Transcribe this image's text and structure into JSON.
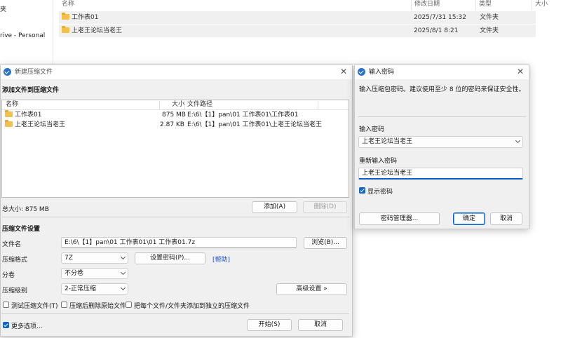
{
  "explorer": {
    "sidebar": [
      "夹",
      "rive - Personal"
    ],
    "columns": [
      "名称",
      "修改日期",
      "类型",
      "大小"
    ],
    "rows": [
      {
        "name": "工作表01",
        "date": "2025/7/31 15:32",
        "type": "文件夹"
      },
      {
        "name": "上老王论坛当老王",
        "date": "2025/8/1 8:21",
        "type": "文件夹"
      }
    ]
  },
  "archive_dialog": {
    "title": "新建压缩文件",
    "section_add": "添加文件到压缩文件",
    "list_columns": {
      "name": "名称",
      "size": "大小",
      "path": "文件路径"
    },
    "files": [
      {
        "name": "工作表01",
        "size": "875 MB",
        "path": "E:\\6\\【1】pan\\01 工作表01\\工作表01"
      },
      {
        "name": "上老王论坛当老王",
        "size": "2.87 KB",
        "path": "E:\\6\\【1】pan\\01 工作表01\\上老王论坛当老王"
      }
    ],
    "total_size": "总大小: 875 MB",
    "add_button": "添加(A)",
    "delete_button": "删除(D)",
    "section_settings": "压缩文件设置",
    "filename_label": "文件名",
    "filename_value": "E:\\6\\【1】pan\\01 工作表01\\01 工作表01.7z",
    "browse_button": "浏览(B)...",
    "format_label": "压缩格式",
    "format_value": "7Z",
    "set_password_button": "设置密码(P)...",
    "help_link": "[帮助]",
    "split_label": "分卷",
    "split_value": "不分卷",
    "level_label": "压缩级别",
    "level_value": "2-正常压缩",
    "advanced_button": "高级设置 »",
    "opt_test": "测试压缩文件(T)",
    "opt_delete": "压缩后删除原始文件",
    "opt_each": "把每个文件/文件夹添加到独立的压缩文件",
    "more_options": "更多选项...",
    "start_button": "开始(S)",
    "cancel_button": "取消"
  },
  "password_dialog": {
    "title": "输入密码",
    "hint": "输入压缩包密码。建议使用至少 8 位的密码来保证安全性。",
    "password_label": "输入密码",
    "password_value": "上老王论坛当老王",
    "confirm_label": "重新输入密码",
    "confirm_value": "上老王论坛当老王",
    "show_password": "显示密码",
    "manager_button": "密码管理器...",
    "ok_button": "确定",
    "cancel_button": "取消"
  }
}
